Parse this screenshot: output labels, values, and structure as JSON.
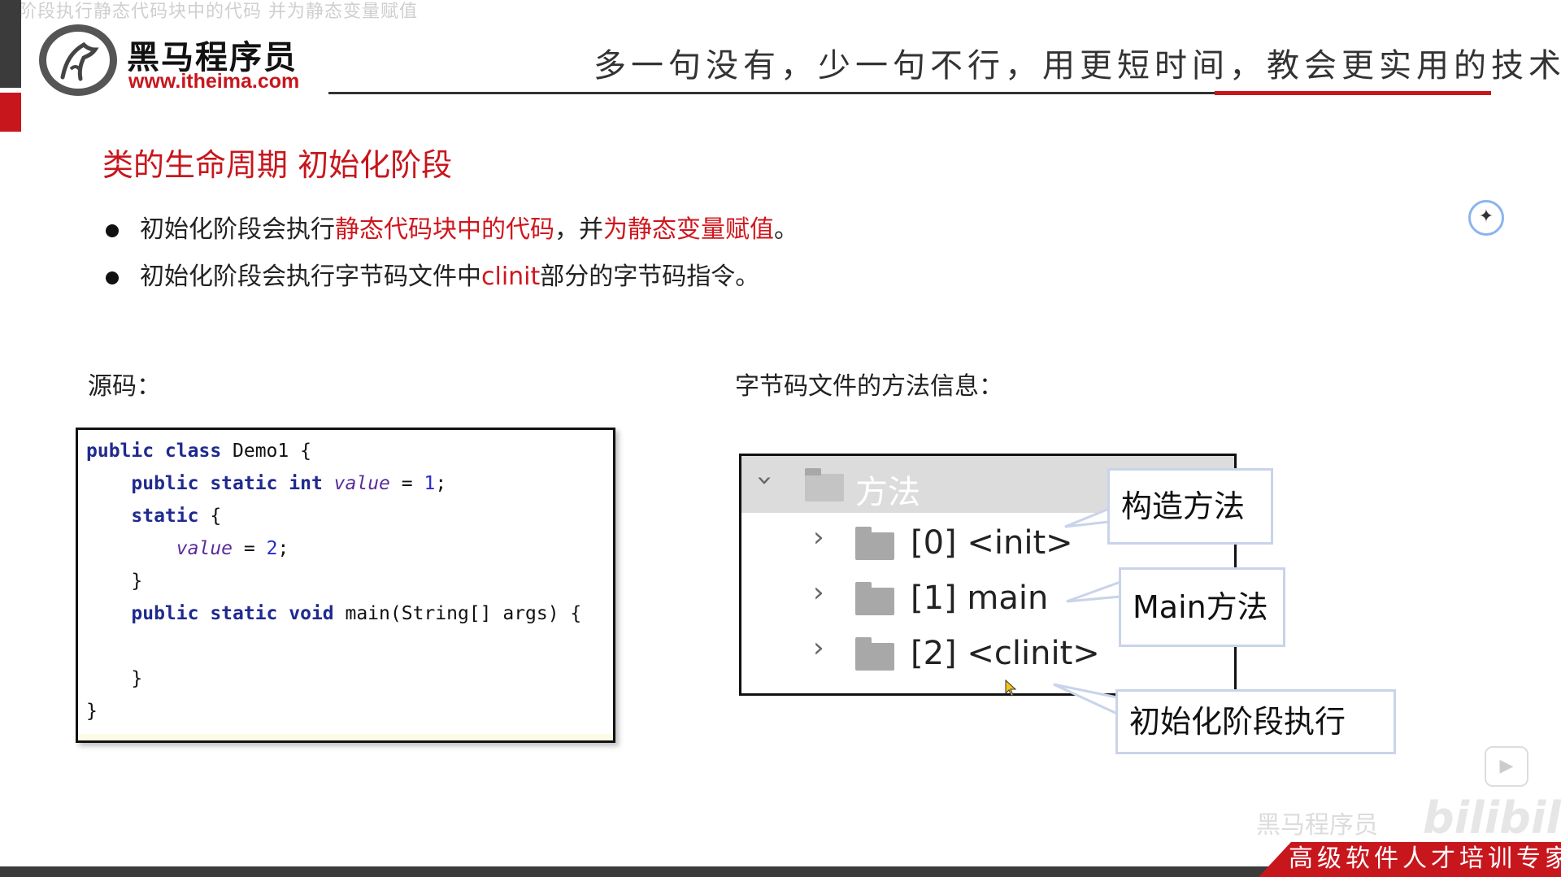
{
  "overlay_caption": "化阶段执行静态代码块中的代码 并为静态变量赋值",
  "header": {
    "brand_name": "黑马程序员",
    "brand_url": "www.itheima.com",
    "slogan": "多一句没有，少一句不行，用更短时间，教会更实用的技术！"
  },
  "slide": {
    "title": "类的生命周期 初始化阶段",
    "bullets": [
      {
        "pre": "初始化阶段会执行",
        "hl1": "静态代码块中的代码",
        "mid": "，并",
        "hl2": "为静态变量赋值",
        "post": "。"
      },
      {
        "pre": "初始化阶段会执行字节码文件中",
        "hl1": "clinit",
        "mid": "部分的字节码指令。"
      }
    ],
    "source_label": "源码：",
    "bytecode_label": "字节码文件的方法信息："
  },
  "code": {
    "line1_kw": "public class",
    "line1_rest": " Demo1 {",
    "line2_kw": "public static int",
    "line2_field": "value",
    "line2_eq": " = ",
    "line2_num": "1",
    "line2_end": ";",
    "line3_kw": "static",
    "line3_rest": " {",
    "line4_field": "value",
    "line4_eq": " = ",
    "line4_num": "2",
    "line4_end": ";",
    "line5": "}",
    "line6_kw": "public static void",
    "line6_rest": " main(String[] args) {",
    "line7": "}",
    "line8": "}"
  },
  "tree": {
    "header_label": "方法",
    "items": [
      {
        "label": "[0] <init>"
      },
      {
        "label": "[1] main"
      },
      {
        "label": "[2] <clinit>"
      }
    ]
  },
  "callouts": {
    "constructor": "构造方法",
    "main": "Main方法",
    "init_phase": "初始化阶段执行"
  },
  "watermark": "黑马程序员",
  "watermark_logo": "bilibili",
  "footer": {
    "tagline": "高级软件人才培训专家"
  }
}
